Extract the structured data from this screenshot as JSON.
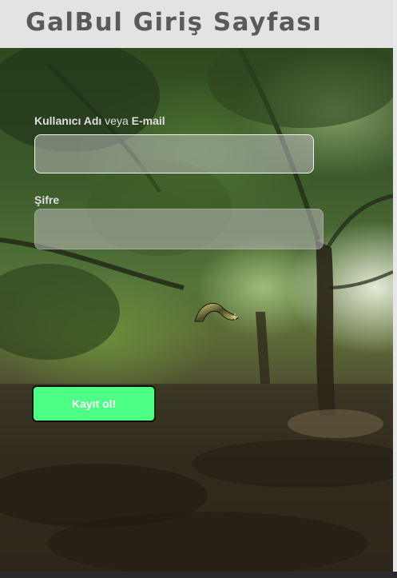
{
  "header": {
    "title": "GalBul Giriş Sayfası"
  },
  "form": {
    "username_label_bold_1": "Kullanıcı Adı",
    "username_label_plain": " veya ",
    "username_label_bold_2": "E-mail",
    "username_value": "",
    "password_label": "Şifre",
    "password_value": ""
  },
  "register_button": {
    "label": "Kayıt ol!"
  },
  "icons": {
    "background": "forest-photo",
    "logo": "swirl-logo-icon"
  },
  "colors": {
    "header_bg": "#e3e3e3",
    "title": "#5a5a5a",
    "button_bg": "#4dff83",
    "label": "#dedede"
  }
}
